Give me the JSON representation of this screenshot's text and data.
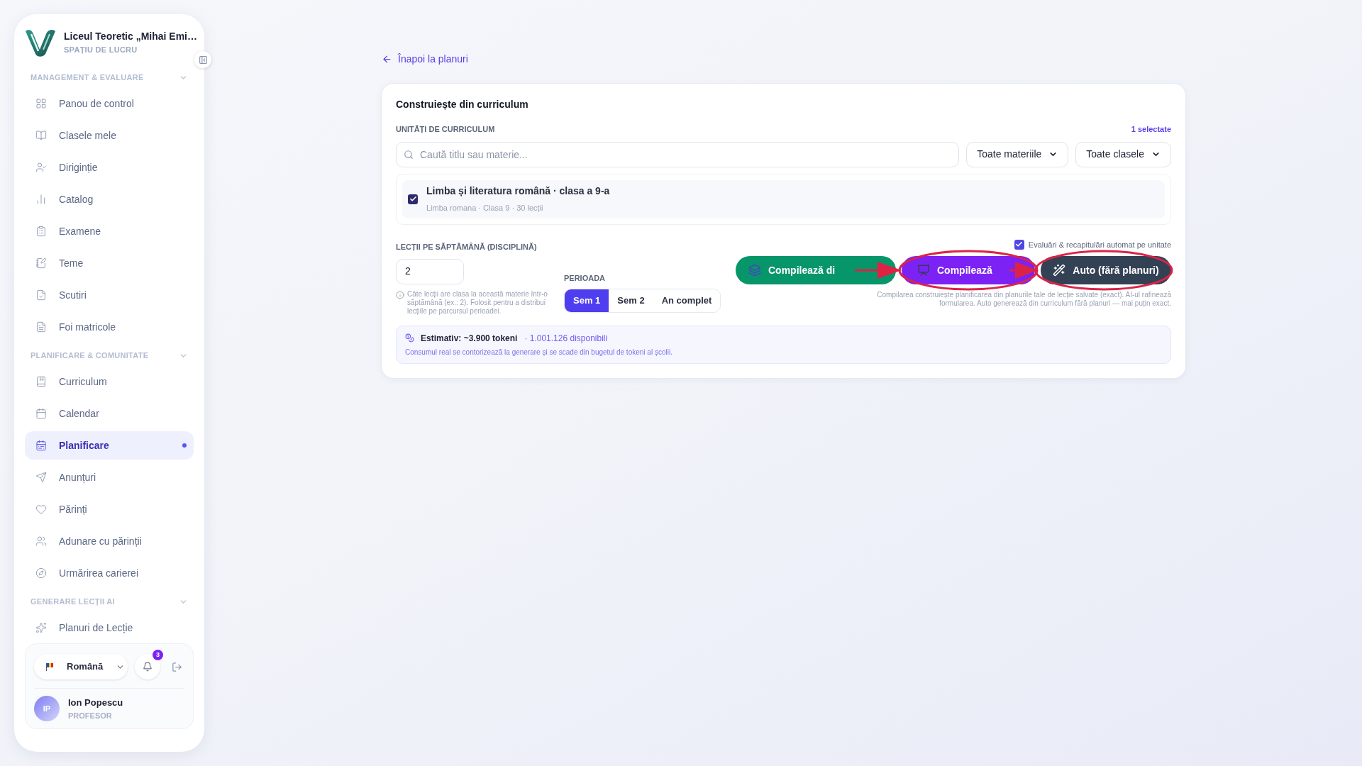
{
  "sidebar": {
    "school_name": "Liceul Teoretic „Mihai Emi…",
    "workspace_label": "SPAȚIU DE LUCRU",
    "sections": [
      {
        "title": "MANAGEMENT & EVALUARE",
        "expanded": true,
        "items": [
          {
            "label": "Panou de control",
            "selected": false
          },
          {
            "label": "Clasele mele",
            "selected": false
          },
          {
            "label": "Diriginție",
            "selected": false
          },
          {
            "label": "Catalog",
            "selected": false
          },
          {
            "label": "Examene",
            "selected": false
          },
          {
            "label": "Teme",
            "selected": false
          },
          {
            "label": "Scutiri",
            "selected": false
          },
          {
            "label": "Foi matricole",
            "selected": false
          }
        ]
      },
      {
        "title": "PLANIFICARE & COMUNITATE",
        "expanded": true,
        "items": [
          {
            "label": "Curriculum",
            "selected": false
          },
          {
            "label": "Calendar",
            "selected": false
          },
          {
            "label": "Planificare",
            "selected": true
          },
          {
            "label": "Anunțuri",
            "selected": false
          },
          {
            "label": "Părinți",
            "selected": false
          },
          {
            "label": "Adunare cu părinții",
            "selected": false
          },
          {
            "label": "Urmărirea carierei",
            "selected": false
          }
        ]
      },
      {
        "title": "GENERARE LECȚII AI",
        "expanded": true,
        "items": [
          {
            "label": "Planuri de Lecție",
            "selected": false
          }
        ]
      }
    ],
    "language": "Română",
    "notification_count": "3",
    "user": {
      "initials": "IP",
      "name": "Ion Popescu",
      "role": "PROFESOR"
    }
  },
  "back_link": "Înapoi la planuri",
  "card": {
    "title": "Construiește din curriculum",
    "units_label": "UNITĂȚI DE CURRICULUM",
    "selected_count": "1 selectate",
    "search": {
      "placeholder": "Caută titlu sau materie..."
    },
    "filters": [
      "Toate materiile",
      "Toate clasele"
    ],
    "units": [
      {
        "title": "Limba și literatura română · clasa a 9-a",
        "meta": "Limba romana · Clasa 9 · 30 lecții",
        "checked": true
      }
    ],
    "lessons_label": "LECȚII PE SĂPTĂMÂNĂ (DISCIPLINĂ)",
    "lessons_value": "2",
    "lessons_hint": "Câte lecții are clasa la această materie într-o săptămână (ex.: 2). Folosit pentru a distribui lecțiile pe parcursul perioadei.",
    "period_label": "PERIOADA",
    "periods": [
      {
        "label": "Sem 1",
        "selected": true
      },
      {
        "label": "Sem 2",
        "selected": false
      },
      {
        "label": "An complet",
        "selected": false
      }
    ],
    "auto_assessments": {
      "label": "Evaluări & recapitulări automat pe unitate",
      "checked": true
    },
    "actions": [
      {
        "kind": "compile_plans",
        "label": "Compilează di"
      },
      {
        "kind": "compile_ai",
        "label": "Compilează"
      },
      {
        "kind": "auto",
        "label": "Auto (fără planuri)"
      }
    ],
    "actions_note": "Compilarea construiește planificarea din planurile tale de lecție salvate (exact). AI-ul rafinează formularea. Auto generează din curriculum fără planuri — mai puțin exact.",
    "estimate": {
      "label": "Estimativ: ~3.900 tokeni",
      "available": "· 1.001.126 disponibili",
      "note": "Consumul real se contorizează la generare și se scade din bugetul de tokeni al școlii."
    }
  }
}
